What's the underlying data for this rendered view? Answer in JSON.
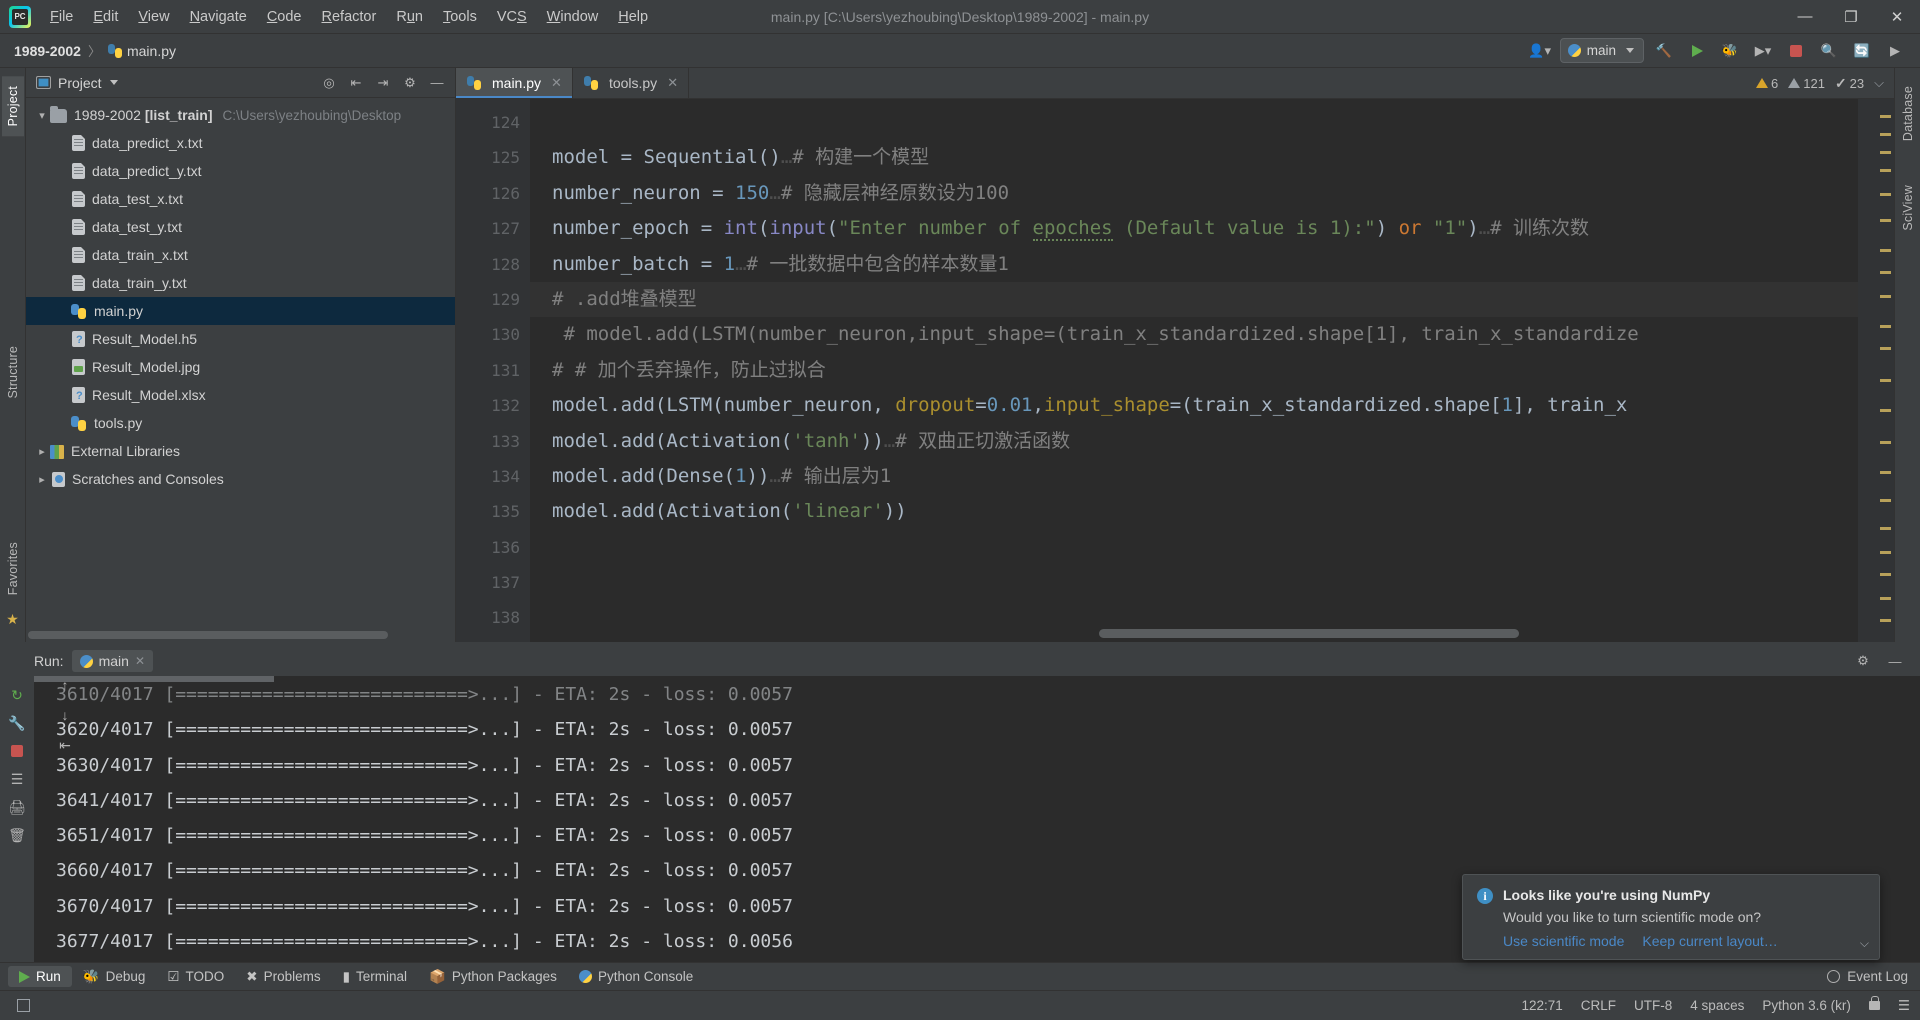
{
  "window": {
    "title": "main.py [C:\\Users\\yezhoubing\\Desktop\\1989-2002] - main.py",
    "minimize": "—",
    "maximize": "❐",
    "close": "✕"
  },
  "menu": {
    "items": [
      {
        "label": "File"
      },
      {
        "label": "Edit"
      },
      {
        "label": "View"
      },
      {
        "label": "Navigate"
      },
      {
        "label": "Code"
      },
      {
        "label": "Refactor"
      },
      {
        "label": "Run"
      },
      {
        "label": "Tools"
      },
      {
        "label": "VCS"
      },
      {
        "label": "Window"
      },
      {
        "label": "Help"
      }
    ]
  },
  "navbar": {
    "project_crumb": "1989-2002",
    "separator": "〉",
    "file_crumb": "main.py",
    "run_config": "main",
    "icons": {
      "user": "user-icon",
      "build": "hammer-icon",
      "run": "run-icon",
      "debug": "debug-icon",
      "coverage": "coverage-icon",
      "stop": "stop-icon",
      "search": "search-icon",
      "update": "update-icon",
      "plugin": "plugin-icon"
    }
  },
  "left_strip": {
    "tabs": [
      {
        "label": "Project",
        "active": true
      },
      {
        "label": "Structure",
        "active": false
      },
      {
        "label": "Favorites",
        "active": false
      }
    ]
  },
  "right_strip": {
    "tabs": [
      {
        "label": "Database",
        "active": false
      },
      {
        "label": "SciView",
        "active": false
      }
    ]
  },
  "project_panel": {
    "title": "Project",
    "tools": [
      "locate-icon",
      "expand-all-icon",
      "collapse-all-icon",
      "settings-icon",
      "hide-icon"
    ],
    "tree": [
      {
        "label": "1989-2002",
        "bold_suffix": " [list_train]",
        "path": "C:\\Users\\yezhoubing\\Desktop",
        "icon": "folder",
        "indent": 0,
        "arrow": "open",
        "selected": false
      },
      {
        "label": "data_predict_x.txt",
        "icon": "txt",
        "indent": 1,
        "arrow": "none",
        "selected": false
      },
      {
        "label": "data_predict_y.txt",
        "icon": "txt",
        "indent": 1,
        "arrow": "none",
        "selected": false
      },
      {
        "label": "data_test_x.txt",
        "icon": "txt",
        "indent": 1,
        "arrow": "none",
        "selected": false
      },
      {
        "label": "data_test_y.txt",
        "icon": "txt",
        "indent": 1,
        "arrow": "none",
        "selected": false
      },
      {
        "label": "data_train_x.txt",
        "icon": "txt",
        "indent": 1,
        "arrow": "none",
        "selected": false
      },
      {
        "label": "data_train_y.txt",
        "icon": "txt",
        "indent": 1,
        "arrow": "none",
        "selected": false
      },
      {
        "label": "main.py",
        "icon": "py",
        "indent": 1,
        "arrow": "none",
        "selected": true
      },
      {
        "label": "Result_Model.h5",
        "icon": "unknown",
        "indent": 1,
        "arrow": "none",
        "selected": false
      },
      {
        "label": "Result_Model.jpg",
        "icon": "image",
        "indent": 1,
        "arrow": "none",
        "selected": false
      },
      {
        "label": "Result_Model.xlsx",
        "icon": "unknown",
        "indent": 1,
        "arrow": "none",
        "selected": false
      },
      {
        "label": "tools.py",
        "icon": "py",
        "indent": 1,
        "arrow": "none",
        "selected": false
      },
      {
        "label": "External Libraries",
        "icon": "library",
        "indent": 0,
        "arrow": "closed",
        "selected": false
      },
      {
        "label": "Scratches and Consoles",
        "icon": "scratch",
        "indent": 0,
        "arrow": "closed",
        "selected": false
      }
    ]
  },
  "editor": {
    "tabs": [
      {
        "label": "main.py",
        "active": true,
        "close": "✕"
      },
      {
        "label": "tools.py",
        "active": false,
        "close": "✕"
      }
    ],
    "inspections": {
      "warnings": "6",
      "weak_warnings": "121",
      "ok": "23",
      "chevron": "⌵"
    },
    "line_numbers": [
      "124",
      "125",
      "126",
      "127",
      "128",
      "129",
      "130",
      "131",
      "132",
      "133",
      "134",
      "135",
      "136",
      "137",
      "138"
    ],
    "lines": [
      {
        "n": "124",
        "fold": "",
        "current": false,
        "tokens": []
      },
      {
        "n": "125",
        "fold": "",
        "current": false,
        "tokens": [
          {
            "t": "model ",
            "c": "def"
          },
          {
            "t": "= ",
            "c": "par"
          },
          {
            "t": "Sequential",
            "c": "def"
          },
          {
            "t": "()",
            "c": "par"
          },
          {
            "t": " ",
            "c": "dot"
          },
          {
            "t": "# 构建一个模型",
            "c": "cmt"
          }
        ]
      },
      {
        "n": "126",
        "fold": "",
        "current": false,
        "tokens": [
          {
            "t": "number_neuron ",
            "c": "def"
          },
          {
            "t": "= ",
            "c": "par"
          },
          {
            "t": "150",
            "c": "num"
          },
          {
            "t": " ",
            "c": "dot"
          },
          {
            "t": "# 隐藏层神经原数设为100",
            "c": "cmt"
          }
        ]
      },
      {
        "n": "127",
        "fold": "",
        "current": false,
        "tokens": [
          {
            "t": "number_epoch ",
            "c": "def"
          },
          {
            "t": "= ",
            "c": "par"
          },
          {
            "t": "int",
            "c": "bi"
          },
          {
            "t": "(",
            "c": "par"
          },
          {
            "t": "input",
            "c": "bi"
          },
          {
            "t": "(",
            "c": "par"
          },
          {
            "t": "\"Enter number of ",
            "c": "str"
          },
          {
            "t": "epoches",
            "c": "str-sp"
          },
          {
            "t": " (Default value is 1):\"",
            "c": "str"
          },
          {
            "t": ") ",
            "c": "par"
          },
          {
            "t": "or ",
            "c": "kw"
          },
          {
            "t": "\"1\"",
            "c": "str"
          },
          {
            "t": ")",
            "c": "par"
          },
          {
            "t": " ",
            "c": "dot"
          },
          {
            "t": "# 训练次数",
            "c": "cmt"
          }
        ]
      },
      {
        "n": "128",
        "fold": "",
        "current": false,
        "tokens": [
          {
            "t": "number_batch ",
            "c": "def"
          },
          {
            "t": "= ",
            "c": "par"
          },
          {
            "t": "1",
            "c": "num"
          },
          {
            "t": " ",
            "c": "dot"
          },
          {
            "t": "# 一批数据中包含的样本数量1",
            "c": "cmt"
          }
        ]
      },
      {
        "n": "129",
        "fold": "minus",
        "current": true,
        "tokens": [
          {
            "t": "# .add堆叠模型",
            "c": "cmt"
          }
        ]
      },
      {
        "n": "130",
        "fold": "",
        "current": false,
        "tokens": [
          {
            "t": " # model.add(LSTM(number_neuron,input_shape=(train_x_standardized.shape[1], train_x_standardize",
            "c": "cmt"
          }
        ]
      },
      {
        "n": "131",
        "fold": "plus",
        "current": false,
        "tokens": [
          {
            "t": "# # 加个丢弃操作，防止过拟合",
            "c": "cmt"
          }
        ]
      },
      {
        "n": "132",
        "fold": "",
        "current": false,
        "tokens": [
          {
            "t": "model",
            "c": "def"
          },
          {
            "t": ".add(",
            "c": "par"
          },
          {
            "t": "LSTM",
            "c": "def"
          },
          {
            "t": "(number_neuron, ",
            "c": "par"
          },
          {
            "t": "dropout",
            "c": "kwarg"
          },
          {
            "t": "=",
            "c": "par"
          },
          {
            "t": "0.01",
            "c": "num"
          },
          {
            "t": ",",
            "c": "par"
          },
          {
            "t": "input_shape",
            "c": "kwarg"
          },
          {
            "t": "=(train_x_standardized.shape[",
            "c": "par"
          },
          {
            "t": "1",
            "c": "num"
          },
          {
            "t": "], train_x",
            "c": "par"
          }
        ]
      },
      {
        "n": "133",
        "fold": "",
        "current": false,
        "tokens": [
          {
            "t": "model",
            "c": "def"
          },
          {
            "t": ".add(",
            "c": "par"
          },
          {
            "t": "Activation",
            "c": "def"
          },
          {
            "t": "(",
            "c": "par"
          },
          {
            "t": "'tanh'",
            "c": "str"
          },
          {
            "t": "))",
            "c": "par"
          },
          {
            "t": " ",
            "c": "dot"
          },
          {
            "t": "# 双曲正切激活函数",
            "c": "cmt"
          }
        ]
      },
      {
        "n": "134",
        "fold": "",
        "current": false,
        "tokens": [
          {
            "t": "model",
            "c": "def"
          },
          {
            "t": ".add(",
            "c": "par"
          },
          {
            "t": "Dense",
            "c": "def"
          },
          {
            "t": "(",
            "c": "par"
          },
          {
            "t": "1",
            "c": "num"
          },
          {
            "t": "))",
            "c": "par"
          },
          {
            "t": " ",
            "c": "dot"
          },
          {
            "t": "# 输出层为1",
            "c": "cmt"
          }
        ]
      },
      {
        "n": "135",
        "fold": "",
        "current": false,
        "tokens": [
          {
            "t": "model",
            "c": "def"
          },
          {
            "t": ".add(",
            "c": "par"
          },
          {
            "t": "Activation",
            "c": "def"
          },
          {
            "t": "(",
            "c": "par"
          },
          {
            "t": "'linear'",
            "c": "str"
          },
          {
            "t": "))",
            "c": "par"
          }
        ]
      },
      {
        "n": "136",
        "fold": "",
        "current": false,
        "tokens": []
      },
      {
        "n": "137",
        "fold": "",
        "current": false,
        "tokens": []
      },
      {
        "n": "138",
        "fold": "",
        "current": false,
        "tokens": []
      }
    ]
  },
  "run_window": {
    "label": "Run:",
    "tab": "main",
    "tab_close": "✕",
    "gutter_icons": [
      "rerun-icon",
      "settings-wrench-icon",
      "scroll-up-icon",
      "scroll-down-icon",
      "soft-wrap-icon",
      "scroll-to-end-icon",
      "stop-icon",
      "print-icon",
      "clear-all-icon"
    ],
    "head_icons": [
      "settings-gear-icon",
      "hide-icon"
    ],
    "console_lines": [
      "3610/4017 [===========================>...] - ETA: 2s - loss: 0.0057",
      "3620/4017 [===========================>...] - ETA: 2s - loss: 0.0057",
      "3630/4017 [===========================>...] - ETA: 2s - loss: 0.0057",
      "3641/4017 [===========================>...] - ETA: 2s - loss: 0.0057",
      "3651/4017 [===========================>...] - ETA: 2s - loss: 0.0057",
      "3660/4017 [===========================>...] - ETA: 2s - loss: 0.0057",
      "3670/4017 [===========================>...] - ETA: 2s - loss: 0.0057",
      "3677/4017 [===========================>...] - ETA: 2s - loss: 0.0056"
    ]
  },
  "notification": {
    "title": "Looks like you're using NumPy",
    "text": "Would you like to turn scientific mode on?",
    "link_primary": "Use scientific mode",
    "link_secondary": "Keep current layout…",
    "icon": "info-icon",
    "chevron": "⌵"
  },
  "bottom_bar": {
    "items": [
      {
        "label": "Run",
        "icon": "run-icon",
        "active": true
      },
      {
        "label": "Debug",
        "icon": "debug-icon",
        "active": false
      },
      {
        "label": "TODO",
        "icon": "todo-icon",
        "active": false
      },
      {
        "label": "Problems",
        "icon": "problems-icon",
        "active": false
      },
      {
        "label": "Terminal",
        "icon": "terminal-icon",
        "active": false
      },
      {
        "label": "Python Packages",
        "icon": "packages-icon",
        "active": false
      },
      {
        "label": "Python Console",
        "icon": "console-icon",
        "active": false
      }
    ],
    "event_log": "Event Log"
  },
  "status_bar": {
    "caret": "122:71",
    "line_sep": "CRLF",
    "encoding": "UTF-8",
    "indent": "4 spaces",
    "interpreter": "Python 3.6 (kr)",
    "lock": "lock-icon",
    "memory": "memory-indicator"
  }
}
